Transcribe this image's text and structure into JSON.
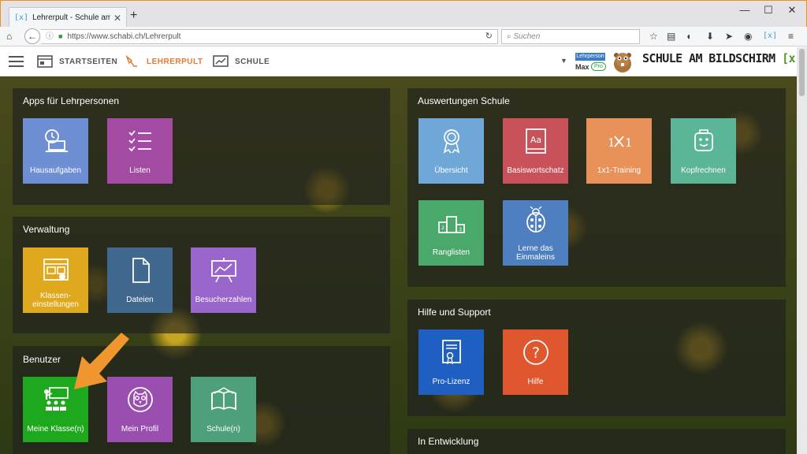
{
  "browser": {
    "tab_title": "Lehrerpult - Schule am Bildsc",
    "tab_favicon": "[x]",
    "url": "https://www.schabi.ch/Lehrerpult",
    "search_placeholder": "Suchen"
  },
  "header": {
    "nav": [
      {
        "label": "STARTSEITEN",
        "icon": "window-icon"
      },
      {
        "label": "LEHRERPULT",
        "icon": "desk-lamp-icon",
        "active": true
      },
      {
        "label": "SCHULE",
        "icon": "chart-board-icon"
      }
    ],
    "user_role": "Lehrperson",
    "user_name": "Max",
    "user_badge": "Pro",
    "brand_text": "SCHULE AM BILDSCHIRM",
    "brand_mark": "[x]"
  },
  "colors": {
    "accent": "#e67a2e",
    "green": "#1faa1f",
    "purple": "#9a4fb0",
    "teal": "#52a07a"
  },
  "sections": {
    "apps": {
      "title": "Apps für Lehrpersonen",
      "tiles": [
        {
          "label": "Hausaufgaben",
          "icon": "clock-laptop-icon",
          "color": "#6f8fd4"
        },
        {
          "label": "Listen",
          "icon": "checklist-icon",
          "color": "#a34aa3"
        }
      ]
    },
    "verwaltung": {
      "title": "Verwaltung",
      "tiles": [
        {
          "label": "Klassen-einstellungen",
          "icon": "class-settings-icon",
          "color": "#e0a81c"
        },
        {
          "label": "Dateien",
          "icon": "file-icon",
          "color": "#41688f"
        },
        {
          "label": "Besucherzahlen",
          "icon": "presentation-chart-icon",
          "color": "#9966cc"
        }
      ]
    },
    "benutzer": {
      "title": "Benutzer",
      "tiles": [
        {
          "label": "Meine Klasse(n)",
          "icon": "classroom-icon",
          "color": "#1ea81e"
        },
        {
          "label": "Mein Profil",
          "icon": "owl-icon",
          "color": "#9a4fb0"
        },
        {
          "label": "Schule(n)",
          "icon": "open-book-icon",
          "color": "#4ea07a"
        }
      ]
    },
    "auswertungen": {
      "title": "Auswertungen Schule",
      "tiles": [
        {
          "label": "Übersicht",
          "icon": "award-icon",
          "color": "#6fa8d8"
        },
        {
          "label": "Basiswortschatz",
          "icon": "dictionary-icon",
          "color": "#c9515a"
        },
        {
          "label": "1x1-Training",
          "icon": "times-table-icon",
          "color": "#e8925a"
        },
        {
          "label": "Kopfrechnen",
          "icon": "robot-head-icon",
          "color": "#5bb596"
        },
        {
          "label": "Ranglisten",
          "icon": "podium-icon",
          "color": "#4aa86a"
        },
        {
          "label": "Lerne das Einmaleins",
          "icon": "ladybug-icon",
          "color": "#4e7fc0"
        }
      ]
    },
    "hilfe": {
      "title": "Hilfe und Support",
      "tiles": [
        {
          "label": "Pro-Lizenz",
          "icon": "certificate-icon",
          "color": "#1f5fc2"
        },
        {
          "label": "Hilfe",
          "icon": "help-icon",
          "color": "#e0562e"
        }
      ]
    },
    "entwicklung": {
      "title": "In Entwicklung"
    }
  }
}
